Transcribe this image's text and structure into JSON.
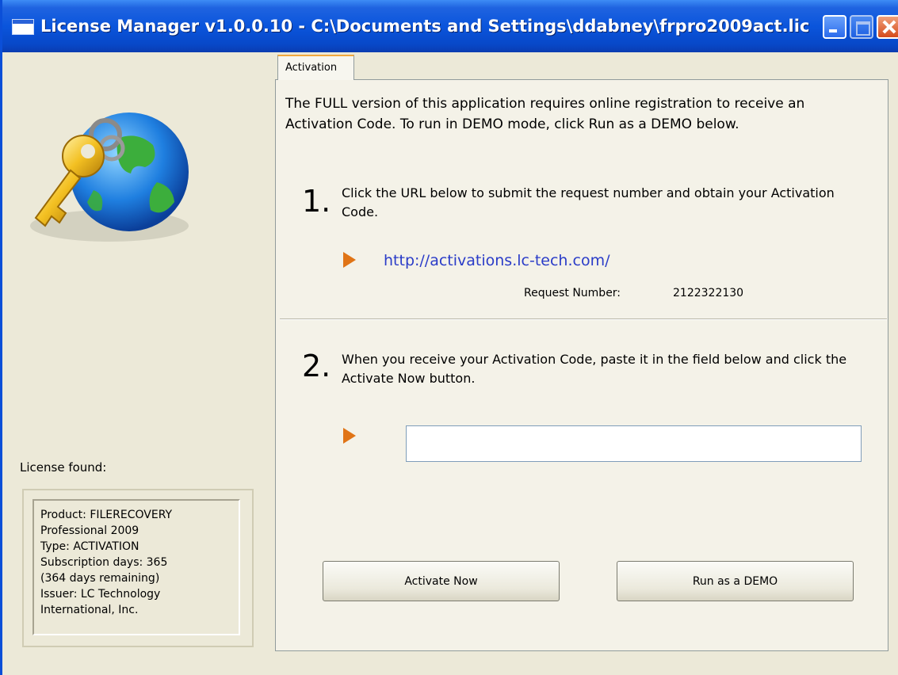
{
  "window": {
    "title": "License Manager v1.0.0.10 - C:\\Documents and Settings\\ddabney\\frpro2009act.lic",
    "title_icon": "app-window-icon",
    "buttons": {
      "minimize": "minimize-icon",
      "maximize": "maximize-icon",
      "close": "close-icon"
    }
  },
  "left": {
    "logo_icon": "key-globe-icon",
    "license_label": "License found:",
    "license_info": "Product: FILERECOVERY\nProfessional 2009\nType: ACTIVATION\nSubscription days: 365\n(364 days remaining)\nIssuer: LC Technology\nInternational, Inc."
  },
  "tabs": [
    {
      "label": "Activation",
      "selected": true
    }
  ],
  "activation": {
    "intro": "The FULL version of this application requires online registration to receive an Activation Code. To run in DEMO mode, click Run as a DEMO below.",
    "step1": {
      "number": "1.",
      "text": "Click the URL below to submit the request number and obtain your Activation Code.",
      "url": "http://activations.lc-tech.com/",
      "request_label": "Request Number:",
      "request_value": "2122322130"
    },
    "step2": {
      "number": "2.",
      "text": "When you receive your Activation Code, paste it in the field below and click the Activate Now button.",
      "code_value": "",
      "code_placeholder": ""
    }
  },
  "buttons": {
    "activate": "Activate Now",
    "demo": "Run as a DEMO"
  },
  "colors": {
    "titlebar": "#0a55dc",
    "window_bg": "#ece9d8",
    "tab_accent": "#f1a83d",
    "arrow": "#e07416",
    "link": "#2a3cc8"
  }
}
